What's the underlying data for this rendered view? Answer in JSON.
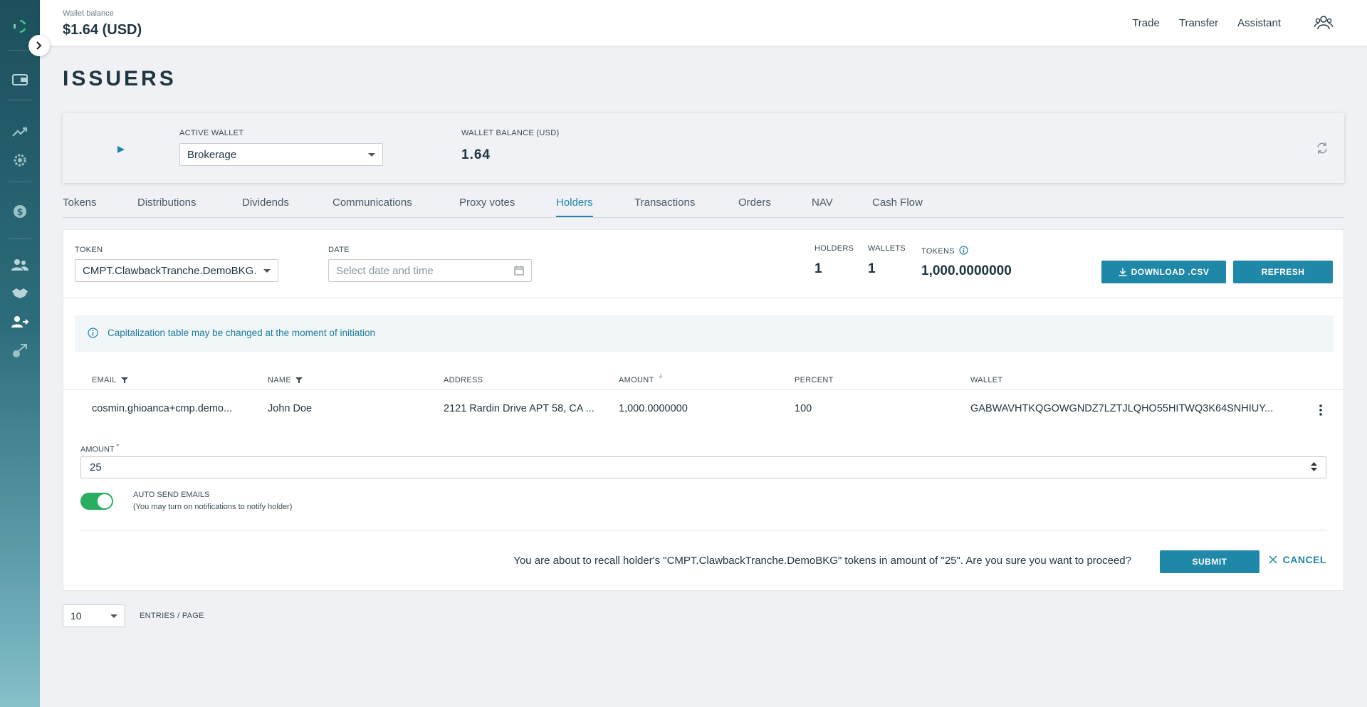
{
  "topbar": {
    "wallet_balance_label": "Wallet balance",
    "wallet_balance_value": "$1.64 (USD)",
    "nav": [
      "Trade",
      "Transfer",
      "Assistant"
    ]
  },
  "page_title": "ISSUERS",
  "wallet_card": {
    "active_wallet_label": "ACTIVE WALLET",
    "active_wallet_value": "Brokerage",
    "balance_label": "WALLET BALANCE (USD)",
    "balance_value": "1.64"
  },
  "tabs": [
    "Tokens",
    "Distributions",
    "Dividends",
    "Communications",
    "Proxy votes",
    "Holders",
    "Transactions",
    "Orders",
    "NAV",
    "Cash Flow"
  ],
  "active_tab": "Holders",
  "filters": {
    "token_label": "TOKEN",
    "token_value": "CMPT.ClawbackTranche.DemoBKG.",
    "date_label": "DATE",
    "date_placeholder": "Select date and time"
  },
  "stats": {
    "holders_label": "HOLDERS",
    "holders_value": "1",
    "wallets_label": "WALLETS",
    "wallets_value": "1",
    "tokens_label": "TOKENS",
    "tokens_value": "1,000.0000000"
  },
  "buttons": {
    "download": "DOWNLOAD .CSV",
    "refresh": "REFRESH",
    "submit": "SUBMIT",
    "cancel": "CANCEL"
  },
  "info_message": "Capitalization table may be changed at the moment of initiation",
  "table": {
    "headers": [
      "EMAIL",
      "NAME",
      "ADDRESS",
      "AMOUNT",
      "PERCENT",
      "WALLET"
    ],
    "rows": [
      [
        "cosmin.ghioanca+cmp.demo...",
        "John Doe",
        "2121 Rardin Drive APT 58, CA ...",
        "1,000.0000000",
        "100",
        "GABWAVHTKQGOWGNDZ7LZTJLQHO55HITWQ3K64SNHIUY..."
      ]
    ]
  },
  "recall_form": {
    "amount_label": "AMOUNT",
    "required_mark": "*",
    "amount_value": "25",
    "auto_send_label": "AUTO SEND EMAILS",
    "auto_send_hint": "(You may turn on notifications to notify holder)",
    "auto_send_on": true,
    "confirm_text": "You are about to recall holder's \"CMPT.ClawbackTranche.DemoBKG\" tokens in amount of \"25\". Are you sure you want to proceed?"
  },
  "pagination": {
    "page_size": "10",
    "label": "ENTRIES / PAGE"
  },
  "colors": {
    "accent": "#1f87a8",
    "toggle_on": "#27ae60",
    "sidebar_top": "#1d4f5c",
    "sidebar_bottom": "#86c0c9"
  }
}
